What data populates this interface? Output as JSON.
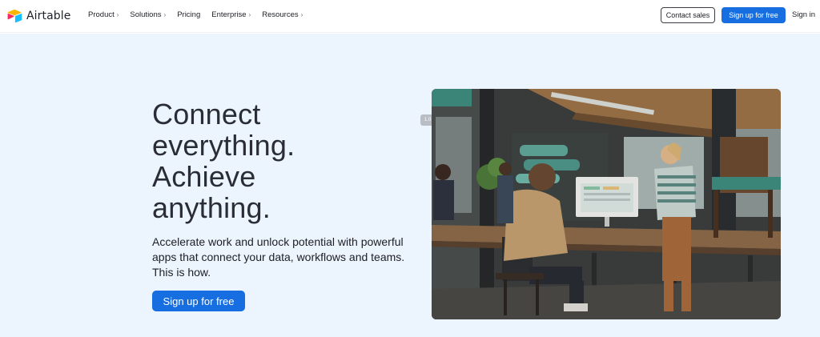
{
  "brand": {
    "name": "Airtable",
    "logo_icon": "airtable-logo-icon",
    "colors": {
      "blue": "#166ee1",
      "yellow": "#fcb400",
      "red": "#f82b60",
      "teal": "#18bfff",
      "hero_bg": "#ecf4fd"
    }
  },
  "nav": {
    "items": [
      {
        "label": "Product",
        "has_chevron": true
      },
      {
        "label": "Solutions",
        "has_chevron": true
      },
      {
        "label": "Pricing",
        "has_chevron": false
      },
      {
        "label": "Enterprise",
        "has_chevron": true
      },
      {
        "label": "Resources",
        "has_chevron": true
      }
    ],
    "chevron_glyph": "›",
    "contact_label": "Contact sales",
    "signup_label": "Sign up for free",
    "signin_label": "Sign in"
  },
  "hero": {
    "headline_lines": [
      "Connect",
      "everything.",
      "Achieve",
      "anything."
    ],
    "subhead": "Accelerate work and unlock potential with powerful apps that connect your data, workflows and teams. This is how.",
    "cta_label": "Sign up for free",
    "image_tag": "1.0",
    "image_description_icon": "office-photo"
  }
}
